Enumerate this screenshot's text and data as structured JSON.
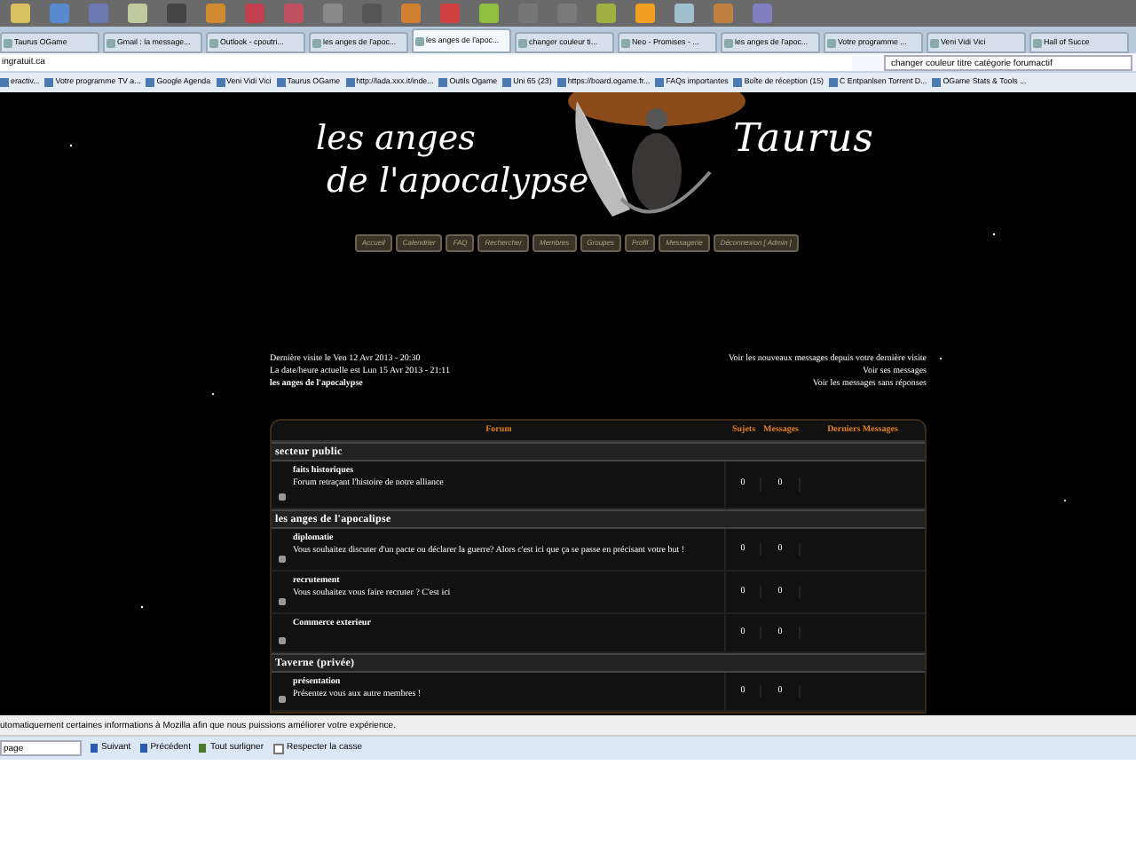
{
  "browser": {
    "tabs": [
      {
        "label": "Taurus OGame",
        "selected": false
      },
      {
        "label": "Gmail : la message...",
        "selected": false
      },
      {
        "label": "Outlook - cpoutri...",
        "selected": false
      },
      {
        "label": "les anges de l'apoc...",
        "selected": false
      },
      {
        "label": "les anges de l'apoc...",
        "selected": true
      },
      {
        "label": "changer couleur ti...",
        "selected": false
      },
      {
        "label": "Neo - Promises - ...",
        "selected": false
      },
      {
        "label": "les anges de l'apoc...",
        "selected": false
      },
      {
        "label": "Votre programme ...",
        "selected": false
      },
      {
        "label": "Veni Vidi Vici",
        "selected": false
      },
      {
        "label": "Hall of Succe",
        "selected": false
      }
    ],
    "address": "ingratuit.ca",
    "search": "changer couleur titre catégorie forumactif",
    "bookmarks": [
      "eractiv...",
      "Votre programme TV a...",
      "Google Agenda",
      "Veni Vidi Vici",
      "Taurus OGame",
      "http://lada.xxx.it/inde...",
      "Outils Ogame",
      "Uni 65 (23)",
      "https://board.ogame.fr...",
      "FAQs importantes",
      "Boîte de réception (15)",
      "C Entpanlsen Torrent D...",
      "OGame Stats & Tools ..."
    ]
  },
  "page": {
    "logo_lines": [
      "les anges",
      "de l'apocalypse"
    ],
    "logo_right": "Taurus",
    "nav": [
      "Accueil",
      "Calendrier",
      "FAQ",
      "Rechercher",
      "Membres",
      "Groupes",
      "Profil",
      "Messagerie",
      "Déconnexion [ Admin ]"
    ],
    "info": [
      "Dernière visite le Ven 12 Avr 2013 - 20:30",
      "La date/heure actuelle est Lun 15 Avr 2013 - 21:11"
    ],
    "forum_name": "les anges de l'apocalypse",
    "links": [
      "Voir les nouveaux messages depuis votre dernière visite",
      "Voir ses messages",
      "Voir les messages sans réponses"
    ],
    "table": {
      "columns": [
        "Forum",
        "Sujets",
        "Messages",
        "Derniers Messages"
      ],
      "sections": [
        {
          "title": "secteur public",
          "forums": [
            {
              "name": "faits historiques",
              "description": "Forum retraçant l'histoire de notre alliance",
              "topics": "0",
              "posts": "0"
            }
          ]
        },
        {
          "title": "les anges de l'apocalipse",
          "forums": [
            {
              "name": "diplomatie",
              "description": "Vous souhaitez discuter d'un pacte ou déclarer la guerre? Alors c'est ici que ça se passe en précisant votre but !",
              "topics": "0",
              "posts": "0"
            },
            {
              "name": "recrutement",
              "description": "Vous souhaitez vous faire recruter ? C'est ici",
              "topics": "0",
              "posts": "0"
            },
            {
              "name": "Commerce exterieur",
              "topics": "0",
              "posts": "0"
            }
          ]
        },
        {
          "title": "Taverne (privée)",
          "forums": [
            {
              "name": "présentation",
              "description": "Présentez vous aux autre membres !",
              "topics": "0",
              "posts": "0"
            }
          ]
        }
      ]
    }
  },
  "notification": "utomatiquement certaines informations à Mozilla afin que nous puissions améliorer votre expérience.",
  "find_bar": {
    "value": "page",
    "buttons": [
      "Suivant",
      "Précédent",
      "Tout surligner"
    ],
    "match_case": {
      "label": "Respecter la casse",
      "checked": false
    }
  }
}
